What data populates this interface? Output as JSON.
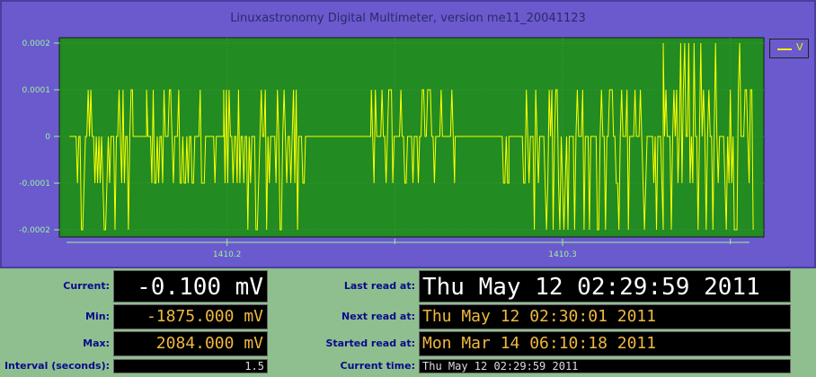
{
  "window": {
    "title": "Linuxastronomy Digital Multimeter, version me11_20041123"
  },
  "colors": {
    "plot_bg": "#228b22",
    "trace": "#ffff00",
    "frame": "#6a5acd",
    "panel": "#8fbf8f",
    "label": "#0a0a8a",
    "readout_orange": "#f0b840"
  },
  "chart_data": {
    "type": "line",
    "ylim": [
      -0.0002,
      0.0002
    ],
    "y_ticks": [
      {
        "value": 0.0002,
        "label": "0.0002"
      },
      {
        "value": 0.0001,
        "label": "0.0001"
      },
      {
        "value": 0,
        "label": "0"
      },
      {
        "value": -0.0001,
        "label": "-0.0001"
      },
      {
        "value": -0.0002,
        "label": "-0.0002"
      }
    ],
    "xlim": [
      1410.15,
      1410.36
    ],
    "x_ticks": [
      {
        "value": 1410.2,
        "label": "1410.2"
      },
      {
        "value": 1410.3,
        "label": "1410.3"
      }
    ],
    "grid": true,
    "legend_position": "top-right",
    "series": [
      {
        "name": "V",
        "color": "#ffff00",
        "segments": [
          {
            "x0": 1410.153,
            "x1": 1410.172,
            "ymin": -0.0002,
            "ymax": 0.0001
          },
          {
            "x0": 1410.172,
            "x1": 1410.176,
            "ymin": 0,
            "ymax": 0
          },
          {
            "x0": 1410.176,
            "x1": 1410.197,
            "ymin": -0.0001,
            "ymax": 0.0001
          },
          {
            "x0": 1410.197,
            "x1": 1410.199,
            "ymin": 0,
            "ymax": 0
          },
          {
            "x0": 1410.199,
            "x1": 1410.224,
            "ymin": -0.0002,
            "ymax": 0.0001
          },
          {
            "x0": 1410.224,
            "x1": 1410.243,
            "ymin": 0,
            "ymax": 0
          },
          {
            "x0": 1410.243,
            "x1": 1410.268,
            "ymin": -0.0001,
            "ymax": 0.0001
          },
          {
            "x0": 1410.268,
            "x1": 1410.28,
            "ymin": 0,
            "ymax": 0
          },
          {
            "x0": 1410.28,
            "x1": 1410.284,
            "ymin": -0.0001,
            "ymax": 0
          },
          {
            "x0": 1410.284,
            "x1": 1410.288,
            "ymin": 0,
            "ymax": 0
          },
          {
            "x0": 1410.288,
            "x1": 1410.33,
            "ymin": -0.0002,
            "ymax": 0.0001
          },
          {
            "x0": 1410.33,
            "x1": 1410.357,
            "ymin": -0.0002,
            "ymax": 0.0002
          }
        ]
      }
    ]
  },
  "readouts": {
    "current": {
      "label": "Current:",
      "value": "-0.100 mV"
    },
    "min": {
      "label": "Min:",
      "value": "-1875.000 mV"
    },
    "max": {
      "label": "Max:",
      "value": "2084.000 mV"
    },
    "interval": {
      "label": "Interval (seconds):",
      "value": "1.5"
    },
    "last_read": {
      "label": "Last read at:",
      "value": "Thu May 12 02:29:59 2011"
    },
    "next_read": {
      "label": "Next read at:",
      "value": "Thu May 12 02:30:01 2011"
    },
    "started_read": {
      "label": "Started read at:",
      "value": "Mon Mar 14 06:10:18 2011"
    },
    "current_time": {
      "label": "Current time:",
      "value": "Thu May 12 02:29:59 2011"
    }
  }
}
